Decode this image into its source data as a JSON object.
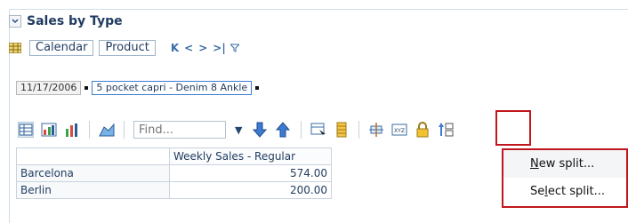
{
  "header": {
    "title": "Sales by Type"
  },
  "filters": {
    "chips": [
      "Calendar",
      "Product"
    ]
  },
  "breadcrumb": {
    "items": [
      "11/17/2006",
      "5 pocket capri - Denim 8 Ankle"
    ]
  },
  "toolbar": {
    "find_placeholder": "Find..."
  },
  "table": {
    "column_header": "Weekly Sales - Regular",
    "rows": [
      {
        "label": "Barcelona",
        "value": "574.00"
      },
      {
        "label": "Berlin",
        "value": "200.00"
      }
    ]
  },
  "context_menu": {
    "items": [
      {
        "label_pre": "",
        "label_accel": "N",
        "label_post": "ew split..."
      },
      {
        "label_pre": "Se",
        "label_accel": "l",
        "label_post": "ect split..."
      }
    ]
  },
  "colors": {
    "accent": "#1f3a5f",
    "highlight": "#c0161d"
  },
  "icons": [
    "collapse-chevron-icon",
    "grid-icon",
    "first-icon",
    "prev-icon",
    "next-icon",
    "last-icon",
    "filter-icon",
    "table-view-icon",
    "chart-table-icon",
    "bar-chart-icon",
    "area-chart-icon",
    "down-arrow-icon",
    "up-arrow-icon",
    "select-icon",
    "column-icon",
    "split-icon",
    "xyz-icon",
    "lock-icon",
    "sort-icon"
  ]
}
